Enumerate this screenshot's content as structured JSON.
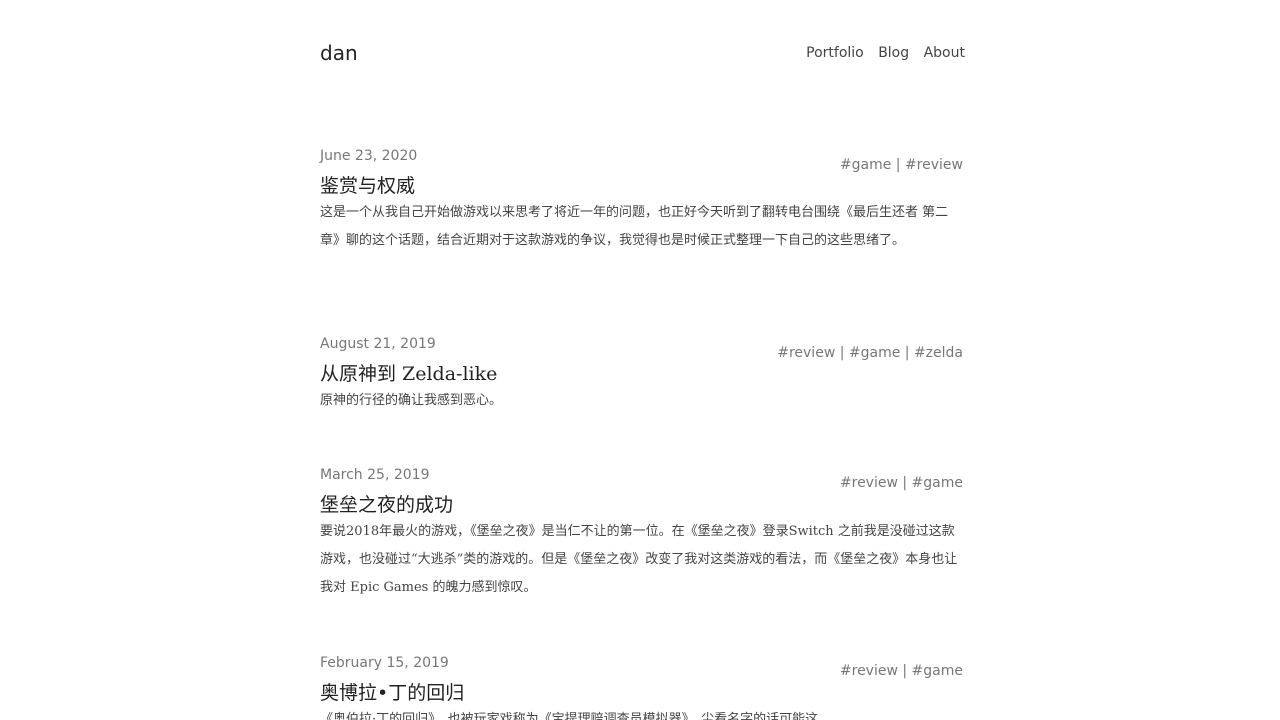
{
  "site": {
    "title": "dan",
    "nav": [
      "Portfolio",
      "Blog",
      "About"
    ]
  },
  "posts": [
    {
      "date": "June 23, 2020",
      "title": "鉴赏与权威",
      "tags": "#game | #review",
      "excerpt": "这是一个从我自己开始做游戏以来思考了将近一年的问题，也正好今天听到了翻转电台围绕《最后生还者 第二章》聊的这个话题，结合近期对于这款游戏的争议，我觉得也是时候正式整理一下自己的这些思绪了。"
    },
    {
      "date": "August 21, 2019",
      "title": "从原神到 Zelda-like",
      "tags": "#review | #game | #zelda",
      "excerpt": "原神的行径的确让我感到恶心。"
    },
    {
      "date": "March 25, 2019",
      "title": "堡垒之夜的成功",
      "tags": "#review | #game",
      "excerpt": "要说2018年最火的游戏，《堡垒之夜》是当仁不让的第一位。在《堡垒之夜》登录Switch 之前我是没碰过这款游戏，也没碰过“大逃杀”类的游戏的。但是《堡垒之夜》改变了我对这类游戏的看法，而《堡垒之夜》本身也让我对 Epic Games 的魄力感到惊叹。"
    },
    {
      "date": "February 15, 2019",
      "title": "奥博拉•丁的回归",
      "tags": "#review | #game",
      "excerpt": "《奥伯拉·丁的回归》，也被玩家戏称为《宝提理赔调查员模拟器》，尘看名字的话可能这"
    }
  ]
}
